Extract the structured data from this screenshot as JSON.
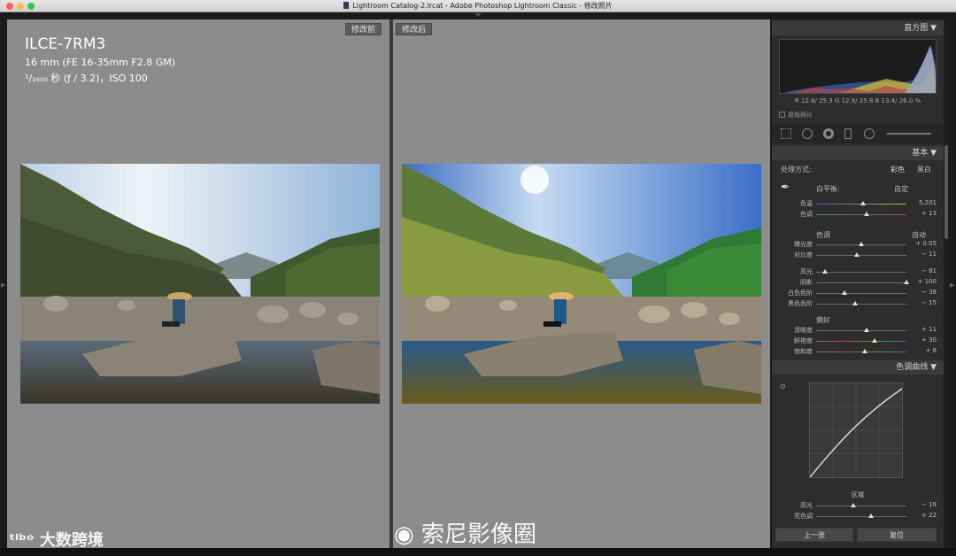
{
  "window": {
    "title": "Lightroom Catalog-2.lrcat - Adobe Photoshop Lightroom Classic - 修改照片"
  },
  "compare": {
    "before_label": "修改前",
    "after_label": "修改后"
  },
  "metadata": {
    "camera": "ILCE-7RM3",
    "lens": "16 mm (FE 16-35mm F2.8 GM)",
    "exposure": "¹/₁₆₀₀ 秒 (ƒ / 3.2)，ISO 100"
  },
  "panel": {
    "histogram_label": "直方图",
    "histogram_values": "R 12.8/ 25.3  G 12.9/ 25.8  B 13.4/ 26.0 %",
    "original_photo_label": "原始照片",
    "basic_label": "基本",
    "treatment_label": "处理方式:",
    "treatment_color": "彩色",
    "treatment_bw": "黑白",
    "wb_label": "白平衡:",
    "wb_value": "自定",
    "temp_label": "色温",
    "temp_value": "5,201",
    "temp_pos": 0.52,
    "tint_label": "色调",
    "tint_value": "+ 13",
    "tint_pos": 0.56,
    "tone_label": "色调",
    "tone_auto": "自动",
    "exposure_label": "曝光度",
    "exposure_value": "+ 0.05",
    "exposure_pos": 0.5,
    "contrast_label": "对比度",
    "contrast_value": "− 11",
    "contrast_pos": 0.45,
    "highlights_label": "高光",
    "highlights_value": "− 81",
    "highlights_pos": 0.1,
    "shadows_label": "阴影",
    "shadows_value": "+ 100",
    "shadows_pos": 1.0,
    "whites_label": "白色色阶",
    "whites_value": "− 38",
    "whites_pos": 0.31,
    "blacks_label": "黑色色阶",
    "blacks_value": "− 15",
    "blacks_pos": 0.43,
    "presence_label": "偏好",
    "clarity_label": "清晰度",
    "clarity_value": "+ 11",
    "clarity_pos": 0.56,
    "vibrance_label": "鲜艳度",
    "vibrance_value": "+ 30",
    "vibrance_pos": 0.65,
    "saturation_label": "饱和度",
    "saturation_value": "+ 8",
    "saturation_pos": 0.54,
    "curve_label": "色调曲线",
    "region_label": "区域",
    "rc_high_label": "高光",
    "rc_high_value": "− 18",
    "rc_high_pos": 0.41,
    "rc_light_label": "亮色调",
    "rc_light_value": "+ 22",
    "rc_light_pos": 0.61,
    "prev_button": "上一张",
    "reset_button": "复位"
  },
  "watermarks": {
    "left": "大数跨境",
    "center": "索尼影像圈"
  },
  "colors": {
    "workarea": "#8c8c8c",
    "panel": "#2d2d2d"
  }
}
